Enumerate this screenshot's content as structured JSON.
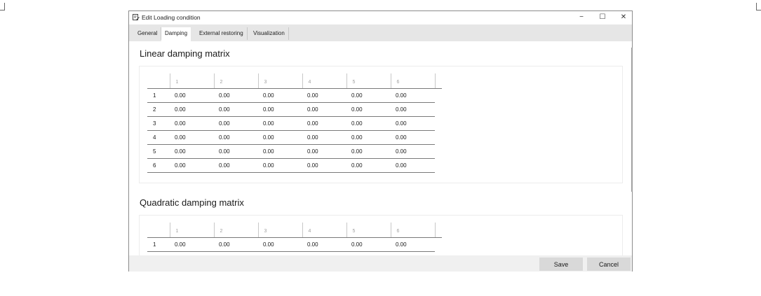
{
  "window": {
    "title": "Edit Loading condition",
    "controls": {
      "minimize": "−",
      "maximize": "☐",
      "close": "✕"
    }
  },
  "tabs": [
    {
      "label": "General",
      "active": false
    },
    {
      "label": "Damping",
      "active": true
    },
    {
      "label": "External restoring",
      "active": false
    },
    {
      "label": "Visualization",
      "active": false
    }
  ],
  "linear": {
    "title": "Linear damping matrix",
    "columns": [
      "1",
      "2",
      "3",
      "4",
      "5",
      "6"
    ],
    "rows": [
      {
        "label": "1",
        "values": [
          "0.00",
          "0.00",
          "0.00",
          "0.00",
          "0.00",
          "0.00"
        ]
      },
      {
        "label": "2",
        "values": [
          "0.00",
          "0.00",
          "0.00",
          "0.00",
          "0.00",
          "0.00"
        ]
      },
      {
        "label": "3",
        "values": [
          "0.00",
          "0.00",
          "0.00",
          "0.00",
          "0.00",
          "0.00"
        ]
      },
      {
        "label": "4",
        "values": [
          "0.00",
          "0.00",
          "0.00",
          "0.00",
          "0.00",
          "0.00"
        ]
      },
      {
        "label": "5",
        "values": [
          "0.00",
          "0.00",
          "0.00",
          "0.00",
          "0.00",
          "0.00"
        ]
      },
      {
        "label": "6",
        "values": [
          "0.00",
          "0.00",
          "0.00",
          "0.00",
          "0.00",
          "0.00"
        ]
      }
    ]
  },
  "quadratic": {
    "title": "Quadratic damping matrix",
    "columns": [
      "1",
      "2",
      "3",
      "4",
      "5",
      "6"
    ],
    "rows": [
      {
        "label": "1",
        "values": [
          "0.00",
          "0.00",
          "0.00",
          "0.00",
          "0.00",
          "0.00"
        ]
      }
    ]
  },
  "footer": {
    "save_label": "Save",
    "cancel_label": "Cancel"
  }
}
